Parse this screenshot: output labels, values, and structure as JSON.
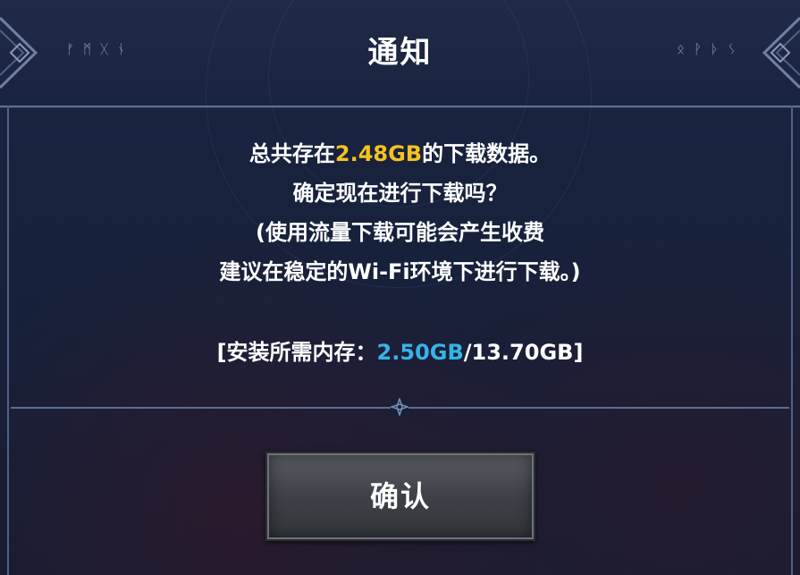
{
  "dialog": {
    "title": "通知",
    "runes_left": "ᚠᛗᚷᚾ",
    "runes_right": "ᛟᚹᚦᛊ",
    "message": {
      "line1_pre": "总共存在",
      "line1_size": "2.48GB",
      "line1_post": "的下载数据。",
      "line2": "确定现在进行下载吗？",
      "line3": "(使用流量下载可能会产生收费",
      "line4": "建议在稳定的Wi-Fi环境下进行下载。)"
    },
    "install_info": {
      "prefix": "[安装所需内存：",
      "required": "2.50GB",
      "suffix": "/13.70GB]"
    },
    "confirm_label": "确认"
  },
  "colors": {
    "highlight_yellow": "#f4c21f",
    "highlight_blue": "#35b4e8",
    "background": "#17203a"
  }
}
